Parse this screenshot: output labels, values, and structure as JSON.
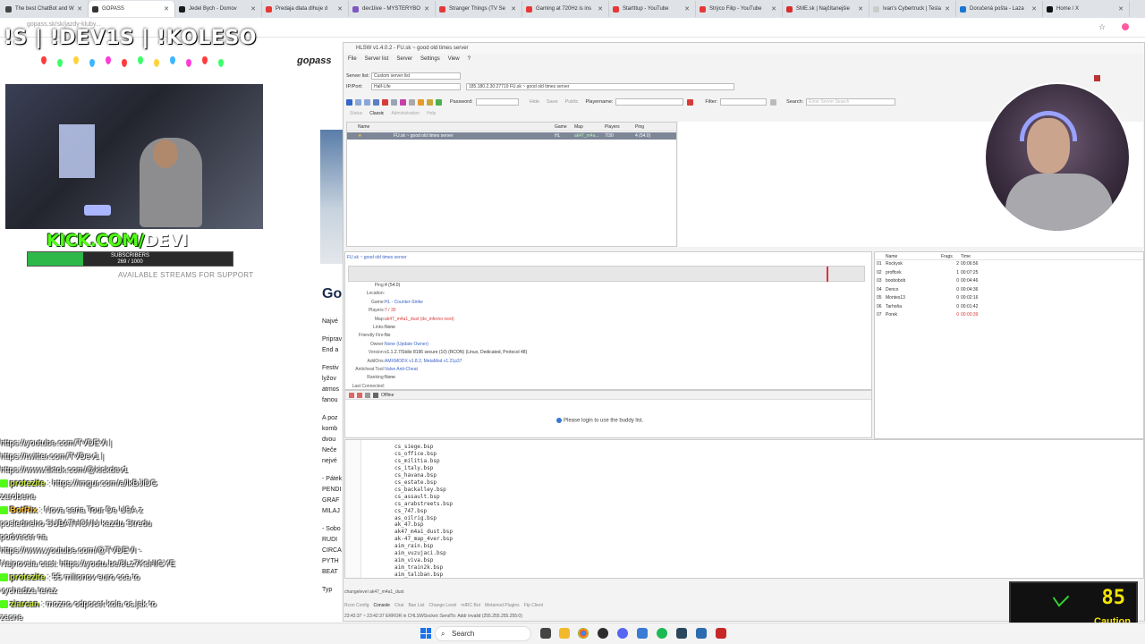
{
  "browser": {
    "tabs": [
      {
        "label": "The best ChatBot and W",
        "color": "#444444"
      },
      {
        "label": "GOPASS",
        "color": "#333333",
        "active": true
      },
      {
        "label": "Jedel Bych - Domov",
        "color": "#1a1a1a"
      },
      {
        "label": "Predaja dlata dlhuje d",
        "color": "#e53935"
      },
      {
        "label": "dev1live - MYSTERYBO",
        "color": "#7e57c2"
      },
      {
        "label": "Stranger Things (TV Se",
        "color": "#e53935"
      },
      {
        "label": "Gaming at 720Hz is ins",
        "color": "#e53935"
      },
      {
        "label": "StartItup - YouTube",
        "color": "#e53935"
      },
      {
        "label": "Strýco Filip - YouTube",
        "color": "#e53935"
      },
      {
        "label": "SME.sk | Najčítanejšie",
        "color": "#d32f2f"
      },
      {
        "label": "Ivan's Cybertruck | Tesla",
        "color": "#cccccc"
      },
      {
        "label": "Doručená pošta - Laza",
        "color": "#1976d2"
      },
      {
        "label": "Home / X",
        "color": "#111111"
      }
    ],
    "address_hint": "gopass.sk/sk/jazdy-kluby...",
    "close_symbol": "✕",
    "star_symbol": "☆"
  },
  "overlay": {
    "title": "!S | !DEV1S | !KOLESO",
    "kick_prefix": "KICK.COM/",
    "kick_name": "DEVI",
    "subs_label": "SUBSCRIBERS",
    "subs_count": "269 / 1000",
    "subs_progress": 0.269,
    "streamer_sub": "AVAILABLE STREAMS FOR SUPPORT"
  },
  "background_page": {
    "brand": "gopass",
    "heading": "Go",
    "lines": [
      "Najvé",
      "Priprav",
      "End a",
      "Festiv",
      "lyžov",
      "atmos",
      "fanou",
      "A poz",
      "komb",
      "dvou",
      "Neče",
      "nejvé",
      "- Pátek",
      "PENDI",
      "GRAF",
      "MILAJ",
      "- Sobo",
      "RUDI",
      "CIRCA",
      "PYTH",
      "BEAT",
      "Typ"
    ]
  },
  "chat": {
    "lines": [
      {
        "user": "",
        "text": "https://youtube.com/TVDEVI |"
      },
      {
        "user": "",
        "text": "https://twitter.com/TVDev1 |"
      },
      {
        "user": "",
        "text": "https://www.tiktok.com/@kickdev1"
      },
      {
        "user": "protezite",
        "text": " : https://imgur.com/a/lkBJiDG"
      },
      {
        "user": "",
        "text": "zarobene"
      },
      {
        "user": "BotRix",
        "text": " : Nova seria Tour De USA z"
      },
      {
        "user": "",
        "text": "posledneho SUBATHONU kazdu Stredu"
      },
      {
        "user": "",
        "text": "podvecer na"
      },
      {
        "user": "",
        "text": "https://www.youtube.com/@TVDEVI -"
      },
      {
        "user": "",
        "text": "Najnovsia cast: https://youtu.be/8Lz7KsHIGYE"
      },
      {
        "user": "protezite",
        "text": " : 55 milionov euro cca to"
      },
      {
        "user": "",
        "text": "vychadza teraz"
      },
      {
        "user": "ziarcan",
        "text": " : mozno odpocet kola os jak to"
      },
      {
        "user": "",
        "text": "zacne"
      }
    ]
  },
  "hlsw": {
    "title": "HLSW v1.4.0.2 - FU.sk ~ good old times server",
    "menu": [
      "File",
      "Server list",
      "Server",
      "Settings",
      "View",
      "?"
    ],
    "server_list_label": "Server list:",
    "server_list_value": "Custom server list",
    "ip_label": "IP/Port:",
    "ip_game": "Half-Life",
    "ip_value": "185.180.2.30:27719 FU.sk ~ good old times server",
    "password_label": "Password:",
    "hide_label": "Hide",
    "save_label": "Save",
    "public_label": "Public",
    "playername_label": "Playername:",
    "filter_label": "Filter:",
    "search_label": "Search:",
    "search_placeholder": "Enter Server Search",
    "view_tabs": [
      "Status",
      "Classic",
      "Administration",
      "Help"
    ],
    "columns": {
      "name": "Name",
      "game": "Game",
      "map": "Map",
      "players": "Players",
      "ping": "Ping"
    },
    "selected_server": {
      "name": "FU.sk ~ good old times server",
      "game": "HL",
      "map": "ak47_m4a...",
      "players": "7/30",
      "ping": "4 (54.0)"
    },
    "detail_link": "FU.sk ~ good old times server",
    "details": [
      {
        "field": "Ping:",
        "value": "4 (54.0)",
        "style": "normal"
      },
      {
        "field": "Location:",
        "value": "",
        "style": "normal"
      },
      {
        "field": "Game:",
        "value": "HL - Counter-Strike",
        "style": "link2"
      },
      {
        "field": "Players:",
        "value": "7 / 30",
        "style": "red"
      },
      {
        "field": "Map:",
        "value": "ak47_m4a1_dust (de_inferno next)",
        "style": "red"
      },
      {
        "field": "Links:",
        "value": "None",
        "style": "normal"
      },
      {
        "field": "Friendly Fire:",
        "value": "No",
        "style": "normal"
      },
      {
        "field": "Owner:",
        "value": "None (Update Owner)",
        "style": "link2"
      },
      {
        "field": "Version:",
        "value": "v1.1.2.7/Stdio 8196 secure (10) (RCON) (Linux, Dedicated, Protocol 48)",
        "style": "normal"
      },
      {
        "field": "AddOns:",
        "value": "AMXMODX v1.8.2, MetaMod v1.21p37",
        "style": "link2"
      },
      {
        "field": "Anticheat Tool:",
        "value": "Valve Anti-Cheat",
        "style": "link2"
      },
      {
        "field": "Ranking:",
        "value": "None",
        "style": "normal"
      },
      {
        "field": "Last Connected:",
        "value": "",
        "style": "normal"
      }
    ],
    "buddy_status": "Offline",
    "buddy_message": "Please login to use the buddy list.",
    "players_columns": {
      "name": "Name",
      "frags": "Frags",
      "time": "Time"
    },
    "players": [
      {
        "num": "01",
        "name": "Rockysk",
        "frags": "2",
        "time": "00:06:56",
        "red": false
      },
      {
        "num": "02",
        "name": "proffcek",
        "frags": "1",
        "time": "00:07:25",
        "red": false
      },
      {
        "num": "03",
        "name": "boobobob",
        "frags": "0",
        "time": "00:04:46",
        "red": false
      },
      {
        "num": "04",
        "name": "Denco",
        "frags": "0",
        "time": "00:04:36",
        "red": false
      },
      {
        "num": "05",
        "name": "Montes13",
        "frags": "0",
        "time": "00:02:16",
        "red": false
      },
      {
        "num": "06",
        "name": "Tarhoňa",
        "frags": "0",
        "time": "00:01:42",
        "red": false
      },
      {
        "num": "07",
        "name": "Porek",
        "frags": "0",
        "time": "00:00:39",
        "red": true
      }
    ],
    "console_maps": [
      "cs_siege.bsp",
      "cs_office.bsp",
      "cs_militia.bsp",
      "cs_italy.bsp",
      "cs_havana.bsp",
      "cs_estate.bsp",
      "cs_backalley.bsp",
      "cs_assault.bsp",
      "cs_arabstreets.bsp",
      "cs_747.bsp",
      "as_oilrig.bsp",
      "ak_47.bsp",
      "ak47_m4a1_dust.bsp",
      "ak-47_map_4ver.bsp",
      "aim_rain.bsp",
      "aim_vuzujaci.bsp",
      "aim_viva.bsp",
      "aim_train2k.bsp",
      "aim_taliban.bsp"
    ],
    "command_line": "changelevel ak47_m4a1_dust",
    "bottom_tabs": [
      "Rcon Config",
      "Console",
      "Chat",
      "Ban List",
      "Change Level",
      "mIRC Bot",
      "Metamod Plugins",
      "Ftp Client"
    ],
    "status_line": "23:42:37 ~ 23:42:37 ERROR in CHLSWSocket::SendTo: Addr invalid (255.255.255.255:0)"
  },
  "caution": {
    "value": "85",
    "label": "Caution"
  },
  "taskbar": {
    "search_label": "Search"
  }
}
